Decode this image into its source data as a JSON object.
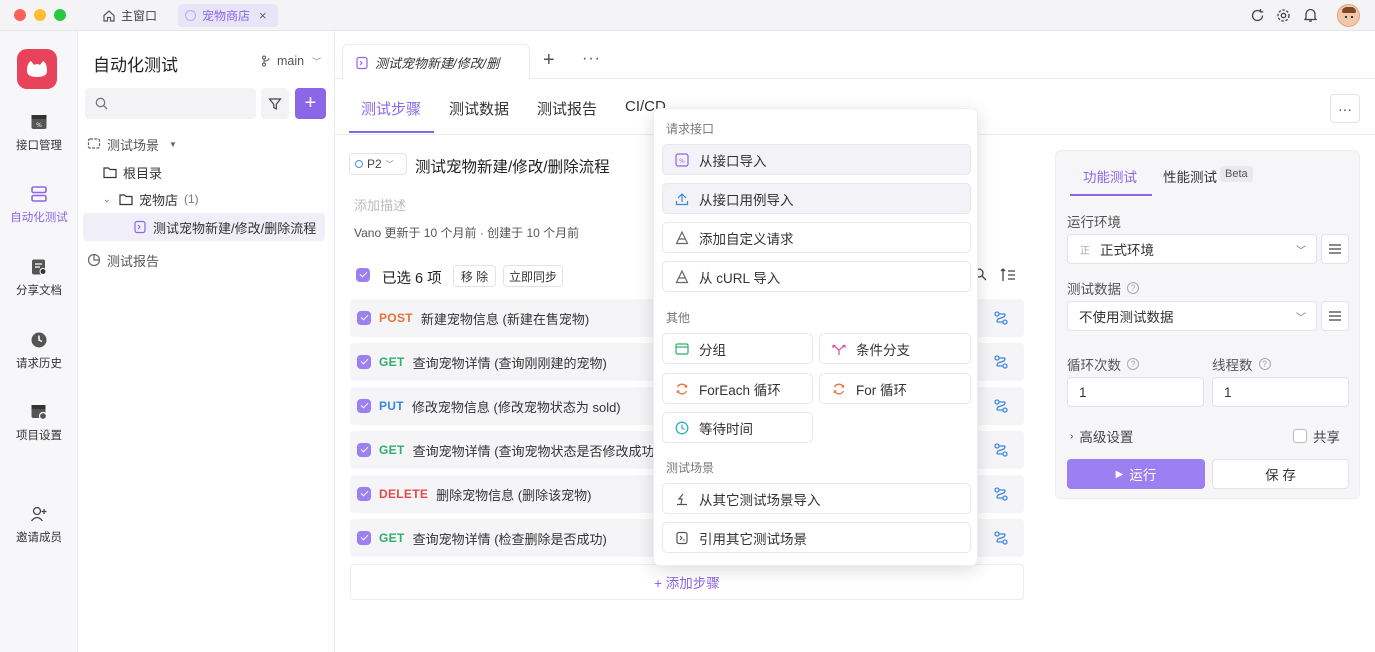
{
  "titlebar": {
    "home_tab": "主窗口",
    "active_tab": "宠物商店"
  },
  "rail": {
    "items": [
      {
        "label": "接口管理",
        "icon": "api-icon"
      },
      {
        "label": "自动化测试",
        "icon": "automation-icon"
      },
      {
        "label": "分享文档",
        "icon": "share-doc-icon"
      },
      {
        "label": "请求历史",
        "icon": "history-icon"
      },
      {
        "label": "项目设置",
        "icon": "settings-icon"
      },
      {
        "label": "邀请成员",
        "icon": "invite-icon"
      }
    ]
  },
  "tree": {
    "title": "自动化测试",
    "branch": "main",
    "scenes_label": "测试场景",
    "root": "根目录",
    "folder": "宠物店",
    "folder_count": "(1)",
    "scenario": "测试宠物新建/修改/删除流程",
    "report": "测试报告"
  },
  "editor": {
    "doc_tab": "测试宠物新建/修改/删",
    "tabs": [
      "测试步骤",
      "测试数据",
      "测试报告",
      "CI/CD"
    ],
    "priority": "P2",
    "title": "测试宠物新建/修改/删除流程",
    "desc_placeholder": "添加描述",
    "meta": "Vano 更新于 10 个月前 · 创建于 10 个月前",
    "selected": "已选 6 项",
    "remove_btn": "移 除",
    "sync_btn": "立即同步",
    "add_step": "+ 添加步骤",
    "steps": [
      {
        "method": "POST",
        "color": "#e8733a",
        "text": "新建宠物信息 (新建在售宠物)"
      },
      {
        "method": "GET",
        "color": "#2fae6e",
        "text": "查询宠物详情 (查询刚刚建的宠物)"
      },
      {
        "method": "PUT",
        "color": "#3a86e0",
        "text": "修改宠物信息 (修改宠物状态为 sold)"
      },
      {
        "method": "GET",
        "color": "#2fae6e",
        "text": "查询宠物详情 (查询宠物状态是否修改成功"
      },
      {
        "method": "DELETE",
        "color": "#e04c4c",
        "text": "删除宠物信息 (删除该宠物)"
      },
      {
        "method": "GET",
        "color": "#2fae6e",
        "text": "查询宠物详情 (检查删除是否成功)"
      }
    ]
  },
  "menu": {
    "sec1": "请求接口",
    "import_api": "从接口导入",
    "import_case": "从接口用例导入",
    "custom_req": "添加自定义请求",
    "curl": "从 cURL 导入",
    "sec2": "其他",
    "group": "分组",
    "cond": "条件分支",
    "foreach": "ForEach 循环",
    "forloop": "For 循环",
    "wait": "等待时间",
    "sec3": "测试场景",
    "import_scene": "从其它测试场景导入",
    "ref_scene": "引用其它测试场景"
  },
  "run_panel": {
    "tab_func": "功能测试",
    "tab_perf": "性能测试",
    "beta": "Beta",
    "env_label": "运行环境",
    "env_badge": "正",
    "env_value": "正式环境",
    "data_label": "测试数据",
    "data_value": "不使用测试数据",
    "loop_label": "循环次数",
    "loop_value": "1",
    "thread_label": "线程数",
    "thread_value": "1",
    "advanced": "高级设置",
    "share": "共享",
    "run_btn": "运行",
    "save_btn": "保 存"
  },
  "colors": {
    "accent": "#8b67e8",
    "logo": "#e8435a"
  }
}
